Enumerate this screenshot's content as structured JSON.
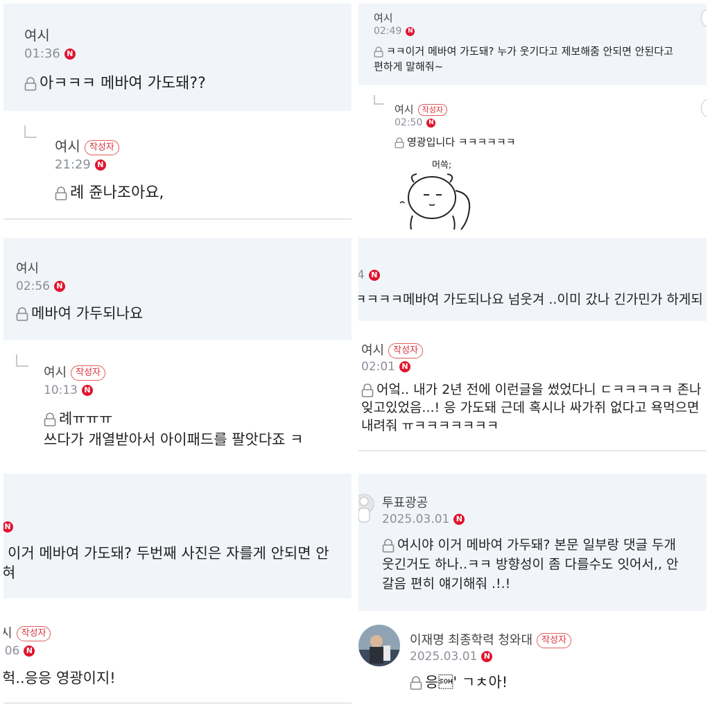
{
  "badge_letter": "N",
  "lock_icon": "lock-icon",
  "panels": {
    "p1": {
      "comment_author": "여시",
      "comment_time": "01:36",
      "comment_text": "아ㅋㅋㅋ 메바여 가도돼??",
      "reply_author": "여시",
      "reply_badge": "작성자",
      "reply_time": "21:29",
      "reply_text": "례 쥰나조아요,"
    },
    "p2": {
      "comment_author": "여시",
      "comment_time": "02:49",
      "comment_text_line1": "ㅋㅋ이거 메바여 가도돼?  누가 웃기다고 제보해줌  안되면 안된다고",
      "comment_text_line2": "편하게 말해줘~",
      "reply_author": "여시",
      "reply_badge": "작성자",
      "reply_time": "02:50",
      "reply_text": "영광입니다 ㅋㅋㅋㅋㅋㅋ",
      "sticker_caption": "머쓱;"
    },
    "p3": {
      "comment_author": "여시",
      "comment_time": "02:56",
      "comment_text": "메바여 가두되나요",
      "reply_author": "여시",
      "reply_badge": "작성자",
      "reply_time": "10:13",
      "reply_text_line1": "례ㅠㅠㅠ",
      "reply_text_line2": "쓰다가 개열받아서 아이패드를 팔앗다죠 ㅋ"
    },
    "p4": {
      "comment_time": "4",
      "comment_text": "ㅋㅋㅋㅋ메바여 가도되나요 넘웃겨 ..이미 갔나 긴가민가 하게되",
      "reply_author": "여시",
      "reply_badge": "작성자",
      "reply_time": "02:01",
      "reply_text_line1": "어엌.. 내가 2년 전에 이런글을 썼었다니 ㄷㅋㅋㅋㅋㅋ 존나",
      "reply_text_line2": "잊고있었음...! 응 가도돼 근데 혹시나 싸가쥐 없다고 욕먹으면",
      "reply_text_line3": "내려줘 ㅠㅋㅋㅋㅋㅋㅋㅋ"
    },
    "p5": {
      "comment_text_line1": "이거 메바여 가도돼? 두번째 사진은 자를게  안되면 안",
      "comment_text_line2": "혀",
      "reply_author": "시",
      "reply_badge": "작성자",
      "reply_time": ":06",
      "reply_text": "헉..응응 영광이지!"
    },
    "p6": {
      "comment_author": "투표광공",
      "comment_time": "2025.03.01",
      "comment_text_line1": "여시야 이거 메바여 가두돼? 본문 일부랑 댓글 두개",
      "comment_text_line2": "웃긴거도 하나..ㅋㅋ  방향성이 좀 다를수도 잇어서,, 안",
      "comment_text_line3": "갈음 편히 얘기해줘 .!.!",
      "reply_author": "이재명 최종학력 청와대",
      "reply_badge": "작성자",
      "reply_time": "2025.03.01",
      "reply_text": "응\u0001' ㄱㅊ아!"
    }
  }
}
